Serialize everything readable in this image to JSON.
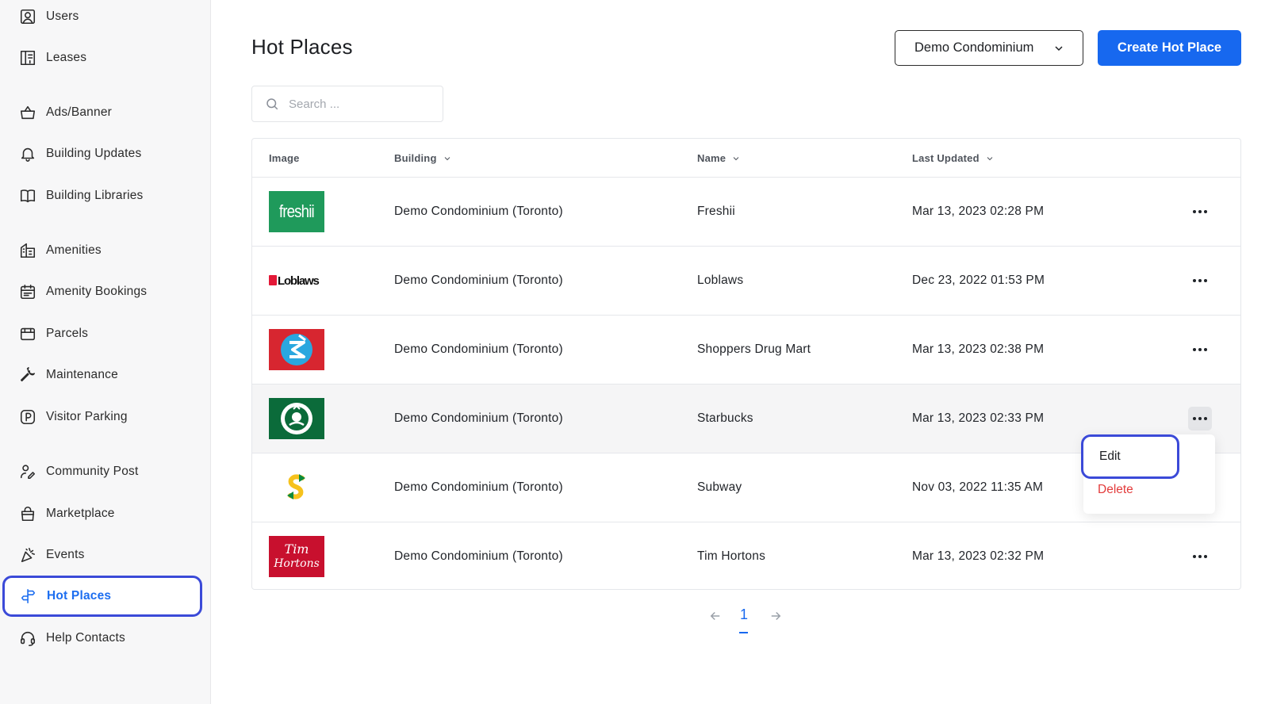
{
  "sidebar": {
    "items": [
      {
        "label": "Users",
        "icon": "user-square-icon"
      },
      {
        "label": "Leases",
        "icon": "lease-document-icon"
      },
      {
        "label": "Ads/Banner",
        "icon": "shopping-bag-icon"
      },
      {
        "label": "Building Updates",
        "icon": "bell-icon"
      },
      {
        "label": "Building Libraries",
        "icon": "book-icon"
      },
      {
        "label": "Amenities",
        "icon": "building-icon"
      },
      {
        "label": "Amenity Bookings",
        "icon": "calendar-icon"
      },
      {
        "label": "Parcels",
        "icon": "parcel-box-icon"
      },
      {
        "label": "Maintenance",
        "icon": "wrench-icon"
      },
      {
        "label": "Visitor Parking",
        "icon": "parking-icon"
      },
      {
        "label": "Community Post",
        "icon": "community-icon"
      },
      {
        "label": "Marketplace",
        "icon": "marketplace-bag-icon"
      },
      {
        "label": "Events",
        "icon": "party-icon"
      },
      {
        "label": "Hot Places",
        "icon": "signpost-icon"
      },
      {
        "label": "Help Contacts",
        "icon": "headset-icon"
      }
    ],
    "active": "Hot Places",
    "accent_color": "#1d6ef0"
  },
  "header": {
    "title": "Hot Places",
    "building_select": "Demo Condominium",
    "create_label": "Create Hot Place"
  },
  "search": {
    "placeholder": "Search ...",
    "value": ""
  },
  "table": {
    "columns": [
      "Image",
      "Building",
      "Name",
      "Last Updated"
    ],
    "rows": [
      {
        "logo": "freshii-logo",
        "building": "Demo Condominium (Toronto)",
        "name": "Freshii",
        "updated": "Mar 13, 2023 02:28 PM"
      },
      {
        "logo": "loblaws-logo",
        "building": "Demo Condominium (Toronto)",
        "name": "Loblaws",
        "updated": "Dec 23, 2022 01:53 PM"
      },
      {
        "logo": "shoppers-logo",
        "building": "Demo Condominium (Toronto)",
        "name": "Shoppers Drug Mart",
        "updated": "Mar 13, 2023 02:38 PM"
      },
      {
        "logo": "starbucks-logo",
        "building": "Demo Condominium (Toronto)",
        "name": "Starbucks",
        "updated": "Mar 13, 2023 02:33 PM"
      },
      {
        "logo": "subway-logo",
        "building": "Demo Condominium (Toronto)",
        "name": "Subway",
        "updated": "Nov 03, 2022 11:35 AM"
      },
      {
        "logo": "tim-hortons-logo",
        "building": "Demo Condominium (Toronto)",
        "name": "Tim Hortons",
        "updated": "Mar 13, 2023 02:32 PM"
      }
    ],
    "logo_text": {
      "freshii": "freshii",
      "loblaws": "Loblaws",
      "tim_line1": "Tim",
      "tim_line2": "Hortons"
    }
  },
  "row_menu": {
    "edit_label": "Edit",
    "delete_label": "Delete"
  },
  "pagination": {
    "current_page": "1"
  },
  "colors": {
    "primary": "#1768ef",
    "danger": "#e33b3b",
    "highlight_border": "#3b4ad8"
  }
}
